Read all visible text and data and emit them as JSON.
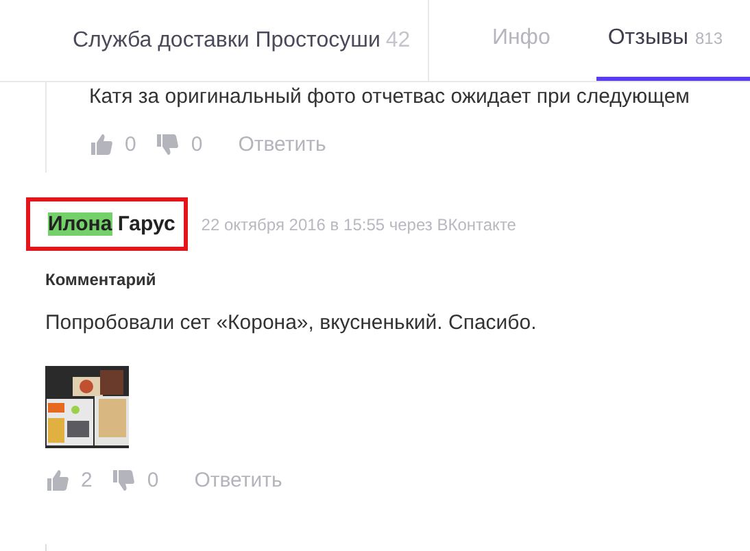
{
  "header": {
    "title": "Служба доставки Простосуши",
    "count": "42",
    "tabs": [
      {
        "label": "Инфо",
        "selected": false
      },
      {
        "label": "Отзывы",
        "count": "813",
        "selected": true
      }
    ]
  },
  "previous_reply": {
    "text": "Катя за оригинальный фото отчетвас ожидает при следующем",
    "likes": "0",
    "dislikes": "0",
    "reply_label": "Ответить"
  },
  "review": {
    "author_first": "Илона",
    "author_last": "Гарус",
    "first_name_highlighted": true,
    "outlined": true,
    "meta": "22 октября 2016 в 15:55 через ВКонтакте",
    "section_label": "Комментарий",
    "text": "Попробовали сет «Корона», вкусненький. Спасибо.",
    "likes": "2",
    "dislikes": "0",
    "reply_label": "Ответить"
  }
}
